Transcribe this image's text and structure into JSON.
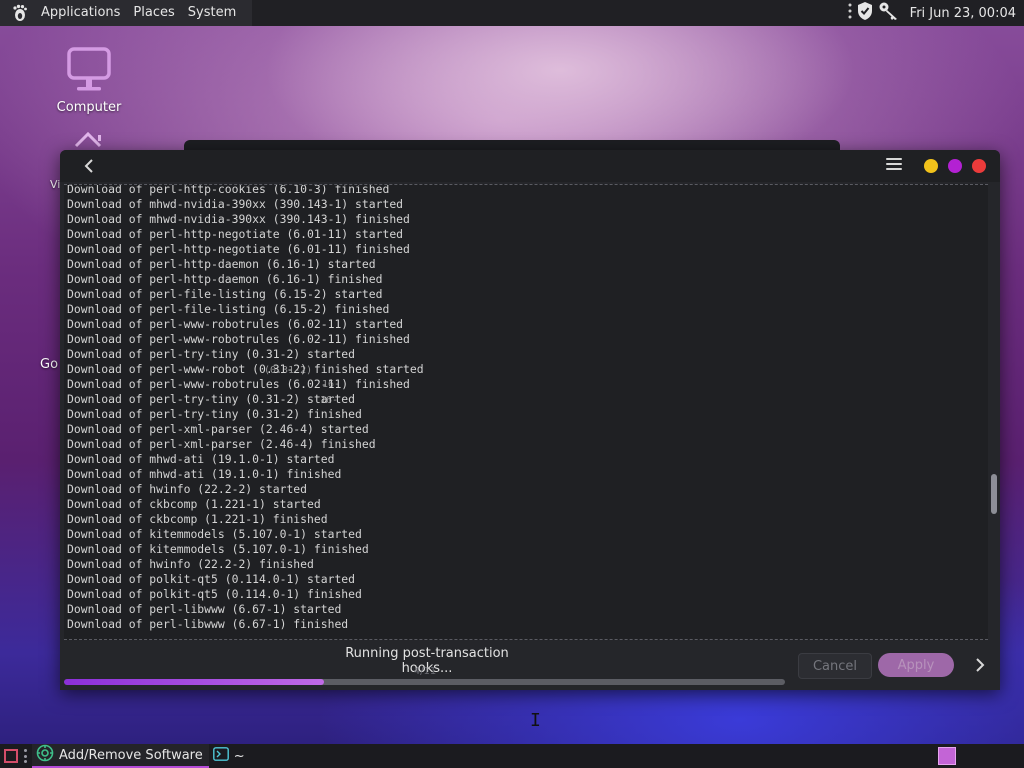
{
  "top_panel": {
    "menus": [
      "Applications",
      "Places",
      "System"
    ],
    "clock": "Fri Jun 23, 00:04"
  },
  "desktop": {
    "icons": [
      {
        "label": "Computer",
        "icon": "monitor-icon"
      }
    ],
    "partial_labels": [
      "Vi",
      "Go"
    ]
  },
  "window": {
    "log_lines": [
      "Download of perl-http-cookies (6.10-3) finished",
      "Download of mhwd-nvidia-390xx (390.143-1) started",
      "Download of mhwd-nvidia-390xx (390.143-1) finished",
      "Download of perl-http-negotiate (6.01-11) started",
      "Download of perl-http-negotiate (6.01-11) finished",
      "Download of perl-http-daemon (6.16-1) started",
      "Download of perl-http-daemon (6.16-1) finished",
      "Download of perl-file-listing (6.15-2) started",
      "Download of perl-file-listing (6.15-2) finished",
      "Download of perl-www-robotrules (6.02-11) started",
      "Download of perl-www-robotrules (6.02-11) finished",
      "Download of perl-try-tiny (0.31-2) started",
      "Download of perl-www-robot (0.31-2) finished started",
      "Download of perl-www-robotrules (6.02-11) finished",
      "Download of perl-try-tiny (0.31-2) started",
      "Download of perl-try-tiny (0.31-2) finished",
      "Download of perl-xml-parser (2.46-4) started",
      "Download of perl-xml-parser (2.46-4) finished",
      "Download of mhwd-ati (19.1.0-1) started",
      "Download of mhwd-ati (19.1.0-1) finished",
      "Download of hwinfo (22.2-2) started",
      "Download of ckbcomp (1.221-1) started",
      "Download of ckbcomp (1.221-1) finished",
      "Download of kitemmodels (5.107.0-1) started",
      "Download of kitemmodels (5.107.0-1) finished",
      "Download of hwinfo (22.2-2) finished",
      "Download of polkit-qt5 (0.114.0-1) started",
      "Download of polkit-qt5 (0.114.0-1) finished",
      "Download of perl-libwww (6.67-1) started",
      "Download of perl-libwww (6.67-1) finished"
    ],
    "status": "Running post-transaction hooks...",
    "step": "4/11",
    "progress": 0.36,
    "cancel_label": "Cancel",
    "apply_label": "Apply"
  },
  "taskbar": {
    "tasks": [
      {
        "label": "Add/Remove Software",
        "icon": "software-manager-icon",
        "active": true
      },
      {
        "label": "~",
        "icon": "terminal-icon",
        "active": false
      }
    ]
  },
  "colors": {
    "accent": "#b54bd8",
    "progress_fill": "#a64be0",
    "minimize": "#f2c21b",
    "maximize": "#b321d3",
    "close": "#ec3b3b"
  }
}
